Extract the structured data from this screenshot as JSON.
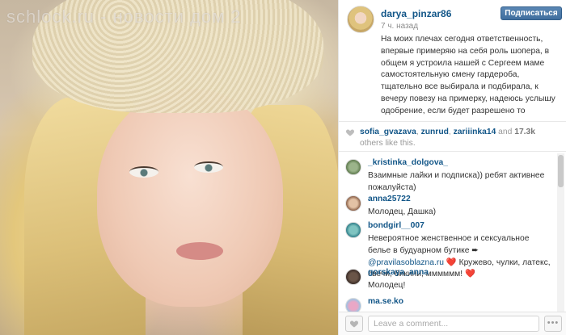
{
  "watermark": "schlock.ru - новости дом 2",
  "post": {
    "username": "darya_pinzar86",
    "time": "7 ч. назад",
    "follow_label": "Подписаться",
    "caption": "На моих плечах сегодня ответственность, впервые примеряю на себя роль шопера, в общем я устроила нашей с Сергеем маме самостоятельную смену гардероба, тщательно все выбирала и подбирала, к вечеру повезу на примерку, надеюсь услышу одобрение, если будет разрешено то фотоотчет скину.Видон у меня вымотанный, знаю, но подобрать размеры"
  },
  "likes": {
    "user1": "sofia_gvazava",
    "sep1": ", ",
    "user2": "zunrud",
    "sep2": ", ",
    "user3": "zariiinka14",
    "and": " and ",
    "count": "17.3k",
    "suffix": " others like this."
  },
  "comments": [
    {
      "user": "_kristinka_dolgova_",
      "text": "Взаимные лайки и подписка)) ребят активнее пожалуйста)"
    },
    {
      "user": "anna25722",
      "text": "Молодец, Дашка)"
    },
    {
      "user": "bondgirl__007",
      "text_before": "Невероятное женственное и сексуальное белье в будуарном бутике ➨ ",
      "link": "@pravilasoblazna.ru",
      "text_after": " ❤️ Кружево, чулки, латекс, свечи, бикини, мммммм! ❤️"
    },
    {
      "user": "gorskaya_anna",
      "text": "Молодец!"
    },
    {
      "user": "ma.se.ko",
      "text": ""
    }
  ],
  "footer": {
    "comment_placeholder": "Leave a comment...",
    "more_label": "•••"
  },
  "colors": {
    "link": "#125688",
    "follow_button": "#3f6e9e"
  }
}
